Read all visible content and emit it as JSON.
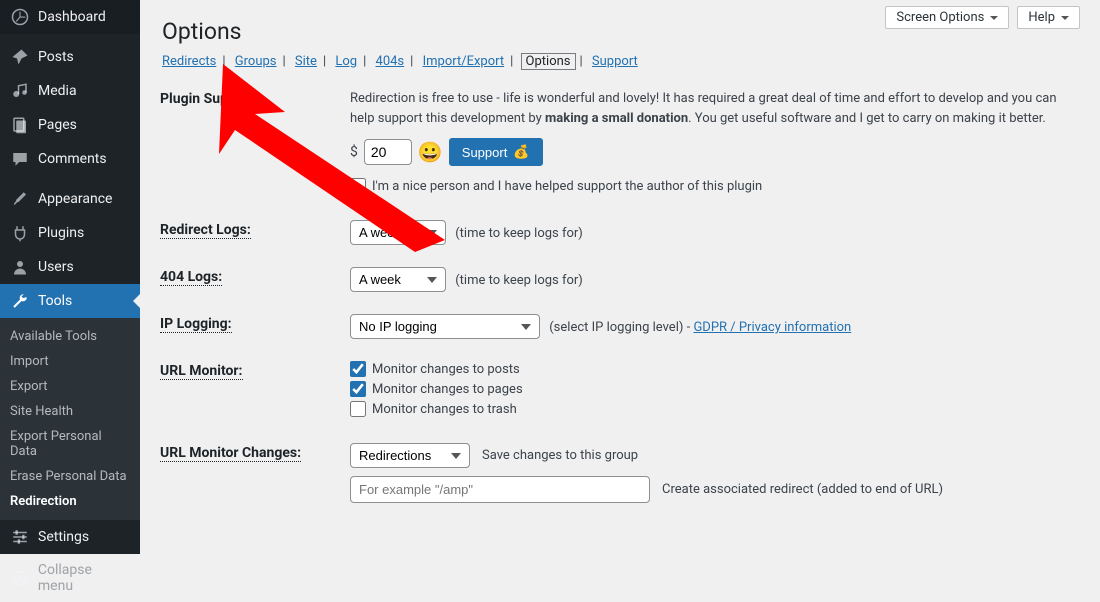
{
  "sidebar": {
    "items": [
      {
        "label": "Dashboard",
        "icon": "⌂"
      },
      {
        "label": "Posts",
        "icon": "📌"
      },
      {
        "label": "Media",
        "icon": "🎵"
      },
      {
        "label": "Pages",
        "icon": "▤"
      },
      {
        "label": "Comments",
        "icon": "💬"
      }
    ],
    "items2": [
      {
        "label": "Appearance",
        "icon": "🖌"
      },
      {
        "label": "Plugins",
        "icon": "🔌"
      },
      {
        "label": "Users",
        "icon": "👤"
      },
      {
        "label": "Tools",
        "icon": "🔧",
        "active": true
      },
      {
        "label": "Settings",
        "icon": "⚙"
      }
    ],
    "submenu": [
      "Available Tools",
      "Import",
      "Export",
      "Site Health",
      "Export Personal Data",
      "Erase Personal Data",
      "Redirection"
    ],
    "submenu_active": 6,
    "collapse_label": "Collapse menu"
  },
  "top": {
    "screen_options": "Screen Options",
    "help": "Help"
  },
  "page_title": "Options",
  "tabs": [
    "Redirects",
    "Groups",
    "Site",
    "Log",
    "404s",
    "Import/Export",
    "Options",
    "Support"
  ],
  "tabs_current": 6,
  "support": {
    "label": "Plugin Support",
    "desc1": "Redirection is free to use - life is wonderful and lovely! It has required a great deal of time and effort to develop and you can help support this development by ",
    "desc_bold": "making a small donation",
    "desc2": ". You get useful software and I get to carry on making it better.",
    "dollar": "$",
    "amount": "20",
    "emoji": "😀",
    "btn": "Support",
    "btn_emoji": "💰",
    "nice_label": "I'm a nice person and I have helped support the author of this plugin"
  },
  "redirect_logs": {
    "label": "Redirect Logs:",
    "value": "A week",
    "after": "(time to keep logs for)"
  },
  "logs404": {
    "label": "404 Logs:",
    "value": "A week",
    "after": "(time to keep logs for)"
  },
  "iplog": {
    "label": "IP Logging:",
    "value": "No IP logging",
    "after": "(select IP logging level) - ",
    "link": "GDPR / Privacy information"
  },
  "urlmon": {
    "label": "URL Monitor:",
    "items": [
      {
        "label": "Monitor changes to posts",
        "checked": true
      },
      {
        "label": "Monitor changes to pages",
        "checked": true
      },
      {
        "label": "Monitor changes to trash",
        "checked": false
      }
    ]
  },
  "urlmonch": {
    "label": "URL Monitor Changes:",
    "group": "Redirections",
    "group_after": "Save changes to this group",
    "placeholder": "For example \"/amp\"",
    "input_after": "Create associated redirect (added to end of URL)"
  }
}
